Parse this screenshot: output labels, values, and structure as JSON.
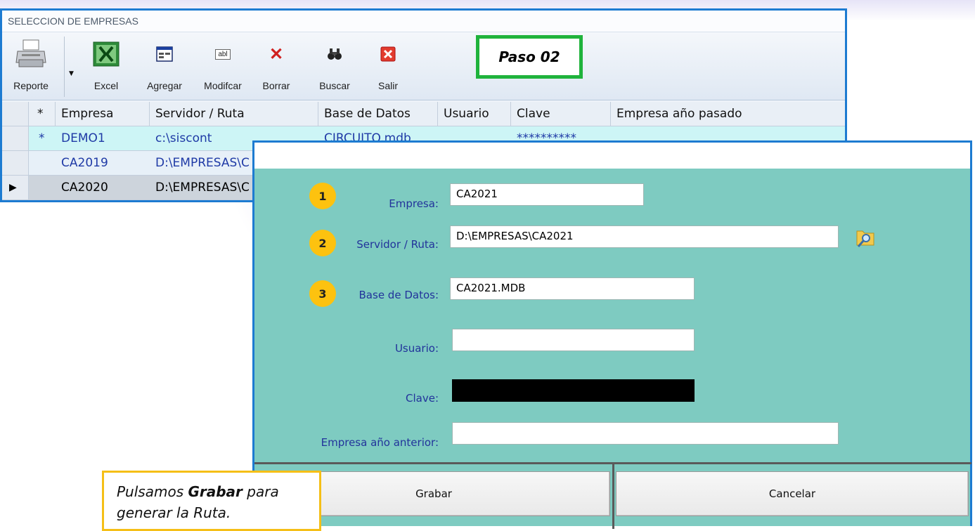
{
  "window": {
    "title": "SELECCION DE EMPRESAS",
    "toolbar": {
      "reporte": "Reporte",
      "excel": "Excel",
      "agregar": "Agregar",
      "modificar": "Modifcar",
      "borrar": "Borrar",
      "buscar": "Buscar",
      "salir": "Salir",
      "agregar_icon_text": "abl"
    },
    "step_label": "Paso 02"
  },
  "grid": {
    "columns": [
      "*",
      "Empresa",
      "Servidor / Ruta",
      "Base de Datos",
      "Usuario",
      "Clave",
      "Empresa año pasado"
    ],
    "rows": [
      {
        "marker": "*",
        "empresa": "DEMO1",
        "ruta": "c:\\siscont",
        "base": "CIRCUITO.mdb",
        "usuario": "",
        "clave": "**********",
        "anterior": ""
      },
      {
        "marker": "",
        "empresa": "CA2019",
        "ruta": "D:\\EMPRESAS\\C",
        "base": "",
        "usuario": "",
        "clave": "",
        "anterior": ""
      },
      {
        "marker": "",
        "empresa": "CA2020",
        "ruta": "D:\\EMPRESAS\\C",
        "base": "",
        "usuario": "",
        "clave": "",
        "anterior": ""
      }
    ]
  },
  "dialog": {
    "fields": {
      "empresa": {
        "label": "Empresa:",
        "value": "CA2021",
        "step": "1"
      },
      "ruta": {
        "label": "Servidor / Ruta:",
        "value": "D:\\EMPRESAS\\CA2021",
        "step": "2"
      },
      "base": {
        "label": "Base de Datos:",
        "value": "CA2021.MDB",
        "step": "3"
      },
      "usuario": {
        "label": "Usuario:",
        "value": ""
      },
      "clave": {
        "label": "Clave:",
        "value": ""
      },
      "anterior": {
        "label": "Empresa año anterior:",
        "value": ""
      }
    },
    "buttons": {
      "grabar": "Grabar",
      "cancelar": "Cancelar"
    }
  },
  "callout": {
    "prefix": "Pulsamos ",
    "bold": "Grabar",
    "suffix": " para generar la Ruta."
  },
  "colors": {
    "window_border": "#1d7bd1",
    "step_border": "#1fb33c",
    "dialog_bg": "#7ecbc1",
    "badge": "#fdc20f",
    "callout_border": "#f5bf17",
    "label_text": "#22339b"
  }
}
